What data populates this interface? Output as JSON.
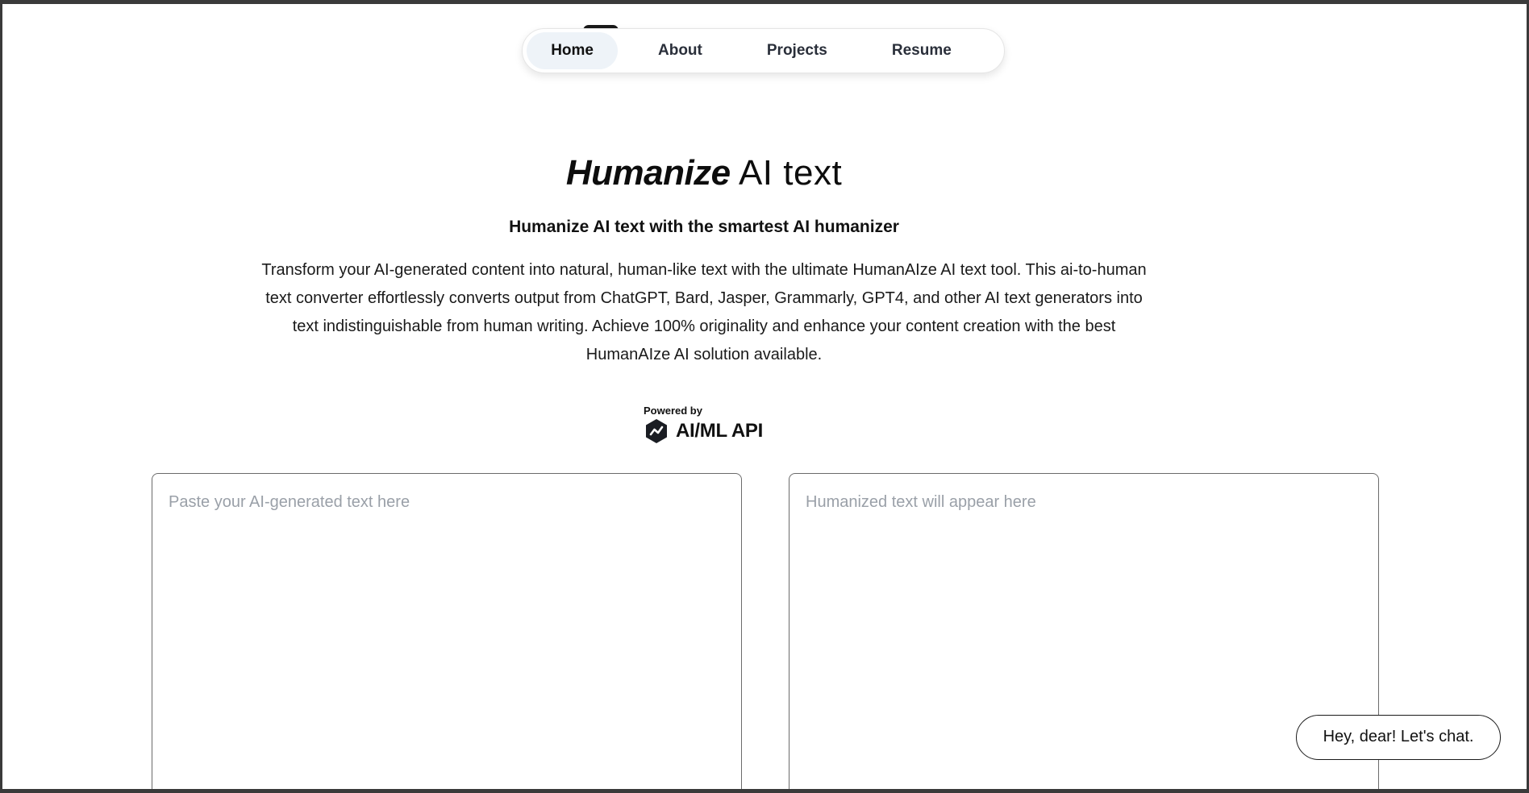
{
  "nav": {
    "items": [
      {
        "label": "Home",
        "active": true
      },
      {
        "label": "About",
        "active": false
      },
      {
        "label": "Projects",
        "active": false
      },
      {
        "label": "Resume",
        "active": false
      }
    ]
  },
  "hero": {
    "title_emphasis": "Humanize",
    "title_rest": " AI text",
    "subtitle": "Humanize AI text with the smartest AI humanizer",
    "description": "Transform your AI-generated content into natural, human-like text with the ultimate HumanAIze AI text tool. This ai-to-human text converter effortlessly converts output from ChatGPT, Bard, Jasper, Grammarly, GPT4, and other AI text generators into text indistinguishable from human writing. Achieve 100% originality and enhance your content creation with the best HumanAIze AI solution available."
  },
  "powered": {
    "label": "Powered by",
    "brand": "AI/ML API",
    "icon": "aiml-logo-icon"
  },
  "input": {
    "placeholder": "Paste your AI-generated text here"
  },
  "output": {
    "placeholder": "Humanized text will appear here"
  },
  "chat": {
    "label": "Hey, dear! Let's chat."
  },
  "colors": {
    "nav_active_bg": "#eef3f8",
    "placeholder": "#9aa0a8",
    "text": "#111111"
  }
}
